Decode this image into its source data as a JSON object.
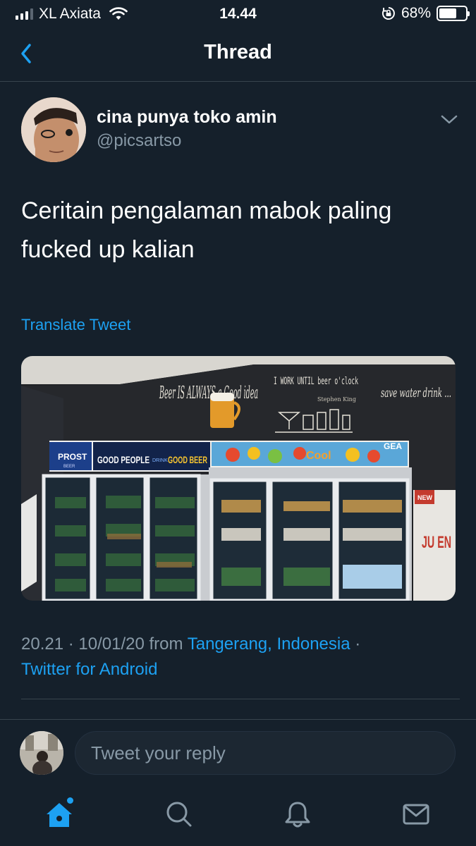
{
  "status_bar": {
    "carrier": "XL Axiata",
    "time": "14.44",
    "battery": "68%",
    "battery_level": 0.68
  },
  "header": {
    "title": "Thread",
    "back_icon": "chevron-left-icon"
  },
  "tweet": {
    "display_name": "cina punya toko amin",
    "handle": "@picsartso",
    "text": "Ceritain pengalaman mabok paling fucked up kalian",
    "translate_label": "Translate Tweet",
    "timestamp": "20.21 · 10/01/20 from ",
    "location": "Tangerang, Indonesia",
    "separator": " ·",
    "source": "Twitter for Android",
    "media_signs": {
      "beer_sign": "Beer IS ALWAYS a Good idea",
      "clock_sign": "I WORK UNTIL beer o'clock",
      "clock_credit": "Stephen King",
      "water_sign": "save water drink ...",
      "brand_prost": "PROST",
      "brand_prost_sub": "BEER",
      "banner_left": "GOOD PEOPLE",
      "banner_middle": "DRINK",
      "banner_right": "GOOD BEER",
      "banner_cool": "Cool",
      "banner_gea": "GEA",
      "poster_new": "NEW",
      "poster_text": "JU EN"
    }
  },
  "reply": {
    "placeholder": "Tweet your reply"
  },
  "tabs": [
    {
      "name": "home",
      "icon": "home-icon"
    },
    {
      "name": "search",
      "icon": "search-icon"
    },
    {
      "name": "notifications",
      "icon": "bell-icon"
    },
    {
      "name": "messages",
      "icon": "mail-icon"
    }
  ],
  "colors": {
    "background": "#15202b",
    "accent": "#1da1f2",
    "secondary_text": "#8899a6",
    "divider": "#38444d"
  }
}
